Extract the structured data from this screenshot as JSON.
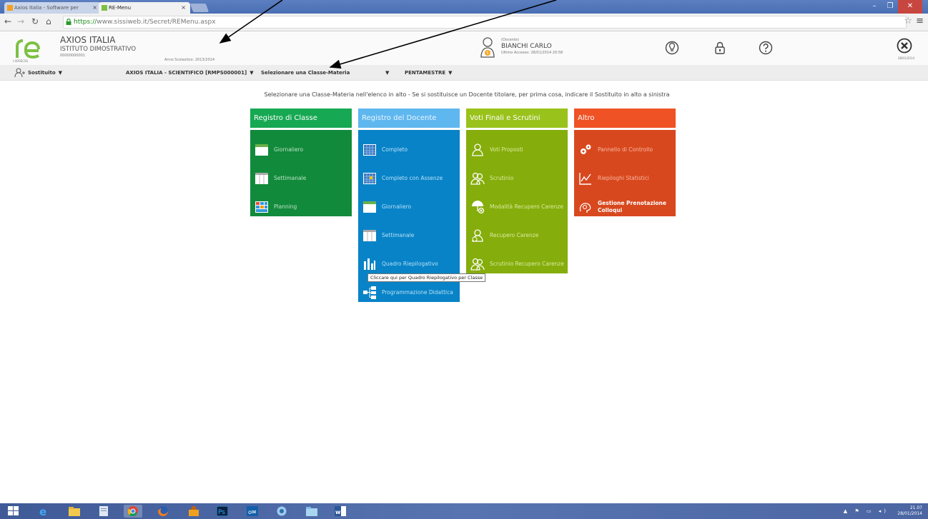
{
  "browser": {
    "tabs": [
      {
        "label": "Axios Italia - Software per"
      },
      {
        "label": "RE-Menu"
      }
    ],
    "url_secure": "https://",
    "url_rest": "www.sissiweb.it/Secret/REMenu.aspx"
  },
  "header": {
    "logo_caption": "I.SOSECSS",
    "school_name": "AXIOS ITALIA",
    "institute": "ISTITUTO DIMOSTRATIVO",
    "code": "00000000001",
    "anno": "Anno Scolastico: 2013/2014",
    "user_badge": "5",
    "user_role": "(Docente)",
    "user_name": "BIANCHI CARLO",
    "last_access": "Ultimo Accesso: 28/01/2014 20:58",
    "close_date": "28/01/2014"
  },
  "filters": {
    "sostituito": "Sostituito",
    "scuola": "AXIOS ITALIA - SCIENTIFICO [RMPS000001]",
    "classe": "Selezionare una Classe-Materia",
    "periodo": "PENTAMESTRE"
  },
  "instruction": "Selezionare una Classe-Materia nell'elenco in alto - Se si sostituisce un Docente titolare, per prima cosa, indicare il Sostituito in alto a sinistra",
  "columns": {
    "registro_classe": {
      "title": "Registro di Classe",
      "items": [
        "Giornaliero",
        "Settimanale",
        "Planning"
      ]
    },
    "registro_docente": {
      "title": "Registro del Docente",
      "items": [
        "Completo",
        "Completo con Assenze",
        "Giornaliero",
        "Settimanale",
        "Quadro Riepilogativo",
        "Programmazione Didattica"
      ]
    },
    "voti_finali": {
      "title": "Voti Finali e Scrutini",
      "items": [
        "Voti Proposti",
        "Scrutinio",
        "Modalità Recupero Carenze",
        "Recupero Carenze",
        "Scrutinio Recupero Carenze"
      ]
    },
    "altro": {
      "title": "Altro",
      "items": [
        "Pannello di Controllo",
        "Riepiloghi Statistici",
        "Gestione Prenotazione Colloqui"
      ]
    }
  },
  "tooltip": "Cliccare qui per Quadro Riepilogativo per Classe",
  "taskbar": {
    "time": "21.07",
    "date": "28/01/2014"
  },
  "colors": {
    "green": "#16a852",
    "blue": "#0883c7",
    "lime": "#99c21a",
    "orange": "#ef5224"
  }
}
